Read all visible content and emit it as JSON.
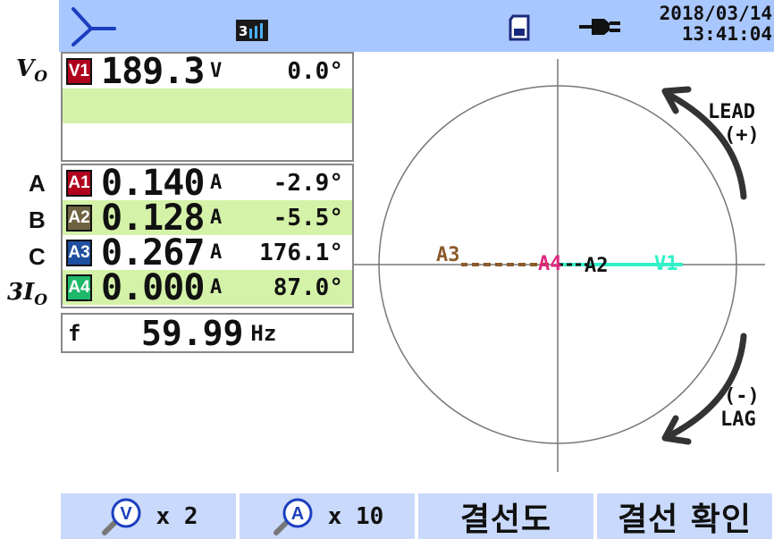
{
  "status_bar": {
    "date": "2018/03/14",
    "time": "13:41:04",
    "mode_icon": "3-phase-measure-icon",
    "storage_icon": "sd-card-icon",
    "power_icon": "ac-plug-icon",
    "wiring_icon": "wye-wiring-icon"
  },
  "side_labels": {
    "voltage": "V",
    "voltage_sub": "O",
    "phase_a": "A",
    "phase_b": "B",
    "phase_c": "C",
    "residual_prefix": "3I",
    "residual_sub": "O"
  },
  "voltage": {
    "tag": "V1",
    "value": "189.3",
    "unit": "V",
    "angle": "0.0°"
  },
  "currents": [
    {
      "tag": "A1",
      "value": "0.140",
      "unit": "A",
      "angle": "-2.9°"
    },
    {
      "tag": "A2",
      "value": "0.128",
      "unit": "A",
      "angle": "-5.5°"
    },
    {
      "tag": "A3",
      "value": "0.267",
      "unit": "A",
      "angle": "176.1°"
    },
    {
      "tag": "A4",
      "value": "0.000",
      "unit": "A",
      "angle": "87.0°"
    }
  ],
  "frequency": {
    "label": "f",
    "value": "59.99",
    "unit": "Hz"
  },
  "phasor": {
    "lead_label": "LEAD",
    "lead_sign": "(+)",
    "lag_sign": "(-)",
    "lag_label": "LAG",
    "vector_labels": {
      "v1": "V1",
      "a2": "A2",
      "a3": "A3",
      "a4": "A4"
    },
    "colors": {
      "v1": "#33f0c8",
      "a1": "#ff1e2e",
      "a2": "#111111",
      "a3": "#8b5a2b",
      "a4": "#e0287e"
    }
  },
  "function_bar": {
    "voltage_zoom": {
      "icon": "voltage-zoom-icon",
      "letter": "V",
      "multiplier": "x 2"
    },
    "current_zoom": {
      "icon": "current-zoom-icon",
      "letter": "A",
      "multiplier": "x 10"
    },
    "wiring_diagram": "결선도",
    "wiring_check": "결선 확인"
  },
  "colors": {
    "status_bar_bg": "#a9c7ff",
    "function_bar_bg": "#c9d9fb",
    "highlight_row": "#d4f2a8",
    "v1_tag": "#b0001e",
    "a1_tag": "#b0001e",
    "a2_tag": "#7a6a40",
    "a3_tag": "#1f4fa0",
    "a4_tag": "#1fb86a"
  }
}
